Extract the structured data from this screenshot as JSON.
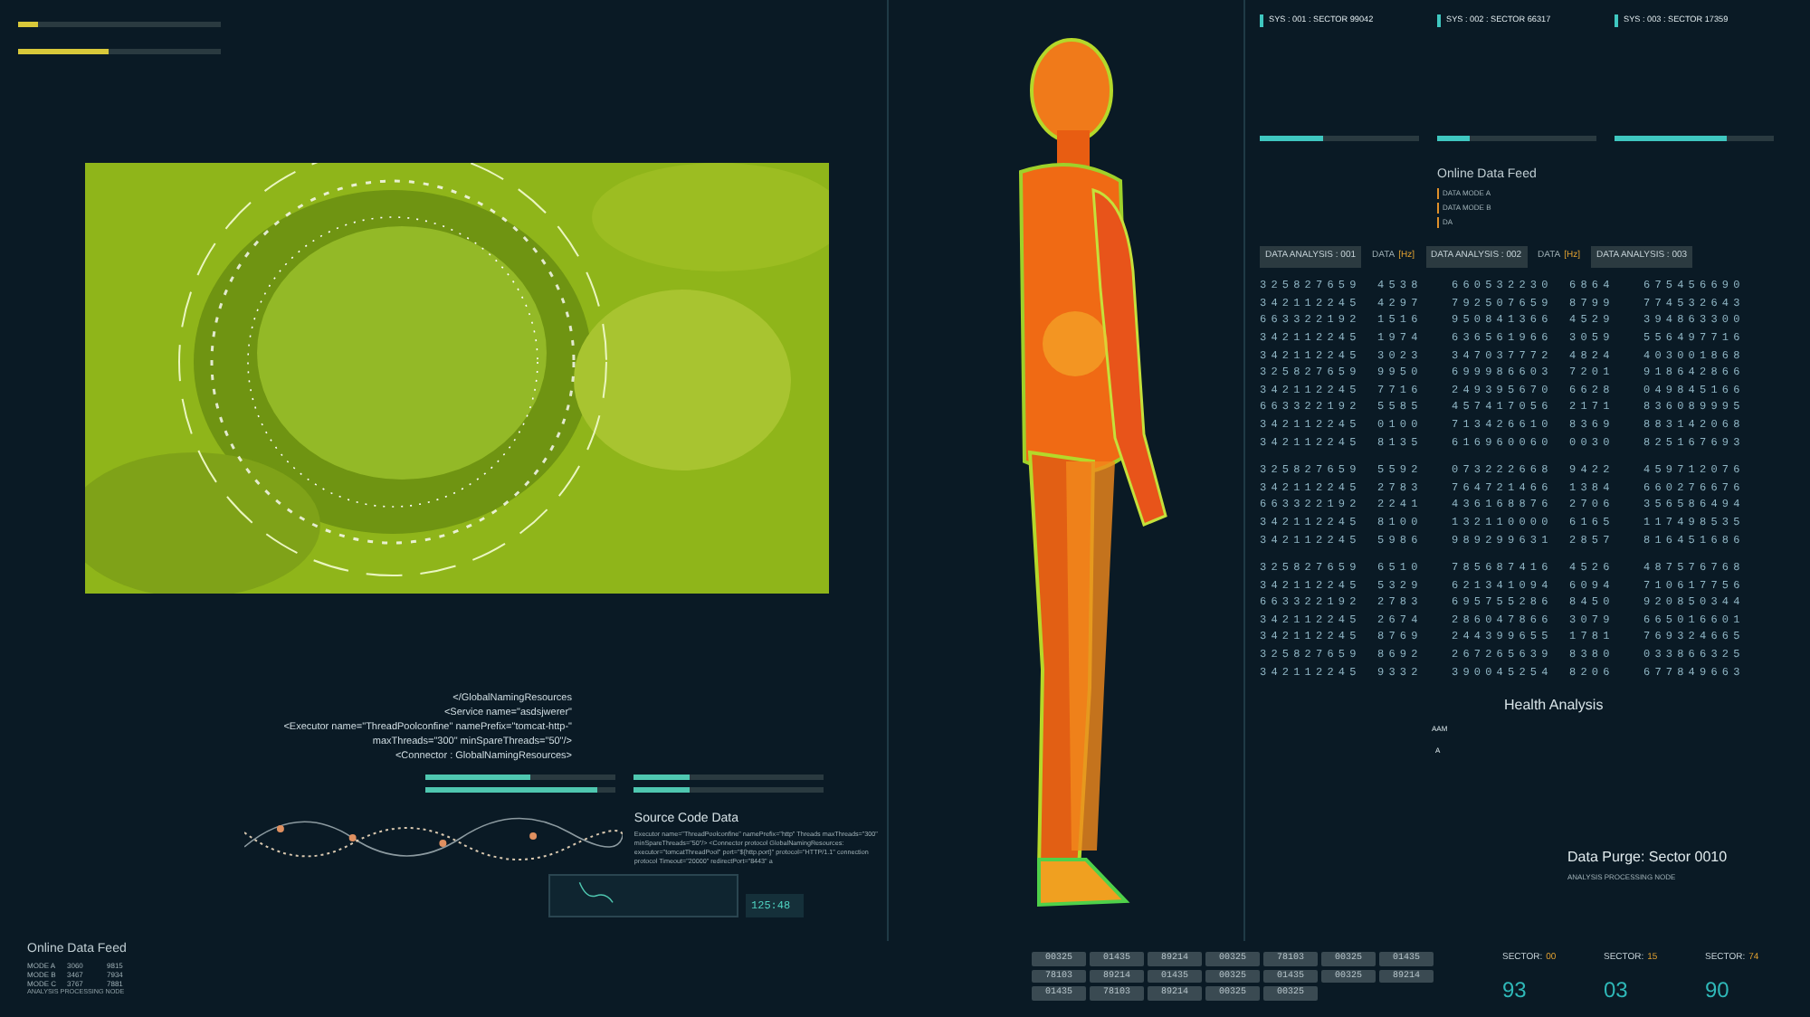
{
  "top_meters": [
    {
      "level": 0.1
    },
    {
      "level": 0.45
    }
  ],
  "systems": [
    {
      "title": "SYS : 001 : SECTOR 99042",
      "bar": {
        "level": 0.4
      }
    },
    {
      "title": "SYS : 002 : SECTOR 66317",
      "bar": {
        "level": 0.2
      }
    },
    {
      "title": "SYS : 003 : SECTOR 17359",
      "bar": {
        "level": 0.7
      }
    }
  ],
  "online_feed": {
    "title": "Online Data Feed",
    "items": [
      "DATA MODE A",
      "DATA MODE B",
      "DA"
    ]
  },
  "analysis_headers": [
    {
      "kind": "box",
      "text": "DATA ANALYSIS : 001"
    },
    {
      "kind": "unit",
      "text": "DATA",
      "unit": "[Hz]"
    },
    {
      "kind": "box",
      "text": "DATA ANALYSIS : 002"
    },
    {
      "kind": "unit",
      "text": "DATA",
      "unit": "[Hz]"
    },
    {
      "kind": "box",
      "text": "DATA ANALYSIS : 003"
    }
  ],
  "tables": [
    [
      [
        "325827659",
        "4538",
        "660532230",
        "6864",
        "675456690"
      ],
      [
        "342112245",
        "4297",
        "792507659",
        "8799",
        "774532643"
      ],
      [
        "663322192",
        "1516",
        "950841366",
        "4529",
        "394863300"
      ],
      [
        "342112245",
        "1974",
        "636561966",
        "3059",
        "556497716"
      ],
      [
        "342112245",
        "3023",
        "347037772",
        "4824",
        "403001868"
      ],
      [
        "325827659",
        "9950",
        "699986603",
        "7201",
        "918642866"
      ],
      [
        "342112245",
        "7716",
        "249395670",
        "6628",
        "049845166"
      ],
      [
        "663322192",
        "5585",
        "457417056",
        "2171",
        "836089995"
      ],
      [
        "342112245",
        "0100",
        "713426610",
        "8369",
        "883142068"
      ],
      [
        "342112245",
        "8135",
        "616960060",
        "0030",
        "825167693"
      ]
    ],
    [
      [
        "325827659",
        "5592",
        "073222668",
        "9422",
        "459712076"
      ],
      [
        "342112245",
        "2783",
        "764721466",
        "1384",
        "660276676"
      ],
      [
        "663322192",
        "2241",
        "436168876",
        "2706",
        "356586494"
      ],
      [
        "342112245",
        "8100",
        "132110000",
        "6165",
        "117498535"
      ],
      [
        "342112245",
        "5986",
        "989299631",
        "2857",
        "816451686"
      ]
    ],
    [
      [
        "325827659",
        "6510",
        "785687416",
        "4526",
        "487576768"
      ],
      [
        "342112245",
        "5329",
        "621341094",
        "6094",
        "710617756"
      ],
      [
        "663322192",
        "2783",
        "695755286",
        "8450",
        "920850344"
      ],
      [
        "342112245",
        "2674",
        "286047866",
        "3079",
        "665016601"
      ],
      [
        "342112245",
        "8769",
        "244399655",
        "1781",
        "769324665"
      ],
      [
        "325827659",
        "8692",
        "267265639",
        "8380",
        "033866325"
      ],
      [
        "342112245",
        "9332",
        "390045254",
        "8206",
        "677849663"
      ]
    ]
  ],
  "health": {
    "title": "Health Analysis",
    "code": "AAM",
    "mark": "A"
  },
  "purge": {
    "title": "Data Purge: Sector 0010",
    "subtitle": "ANALYSIS PROCESSING NODE"
  },
  "xml_lines": [
    "</GlobalNamingResources",
    "<Service name=\"asdsjwerer\"",
    "<Executor name=\"ThreadPoolconfine\" namePrefix=\"tomcat-http-\"",
    "maxThreads=\"300\" minSpareThreads=\"50\"/>",
    "<Connector : GlobalNamingResources>"
  ],
  "gauges": [
    {
      "level": 0.55
    },
    {
      "level": 0.3
    },
    {
      "level": 0.9
    },
    {
      "level": 0.3
    }
  ],
  "source": {
    "title": "Source Code Data",
    "text": "Executor name=\"ThreadPoolconfine\" namePrefix=\"http\" Threads maxThreads=\"300\" minSpareThreads=\"50\"/> <Connector protocol GlobalNamingResources: executor=\"tomcatThreadPool\" port=\"${http.port}\" protocol=\"HTTP/1.1\" connection protocol Timeout=\"20000\" redirectPort=\"8443\" a"
  },
  "clock": "125:48",
  "bottom_feed": {
    "title": "Online Data Feed",
    "rows": [
      [
        "MODE A",
        "3060",
        "9815"
      ],
      [
        "MODE B",
        "3467",
        "7934"
      ],
      [
        "MODE C",
        "3767",
        "7881"
      ]
    ],
    "footer": "ANALYSIS PROCESSING NODE"
  },
  "pills": [
    [
      "00325",
      "01435",
      "89214",
      "00325",
      "78103",
      "00325",
      "01435"
    ],
    [
      "78103",
      "89214",
      "01435",
      "00325",
      "01435",
      "00325",
      "89214"
    ],
    [
      "01435",
      "78103",
      "89214",
      "00325",
      "00325"
    ]
  ],
  "sectors": [
    {
      "label": "SECTOR:",
      "code": "00",
      "value": "93"
    },
    {
      "label": "SECTOR:",
      "code": "15",
      "value": "03"
    },
    {
      "label": "SECTOR:",
      "code": "74",
      "value": "90"
    }
  ]
}
